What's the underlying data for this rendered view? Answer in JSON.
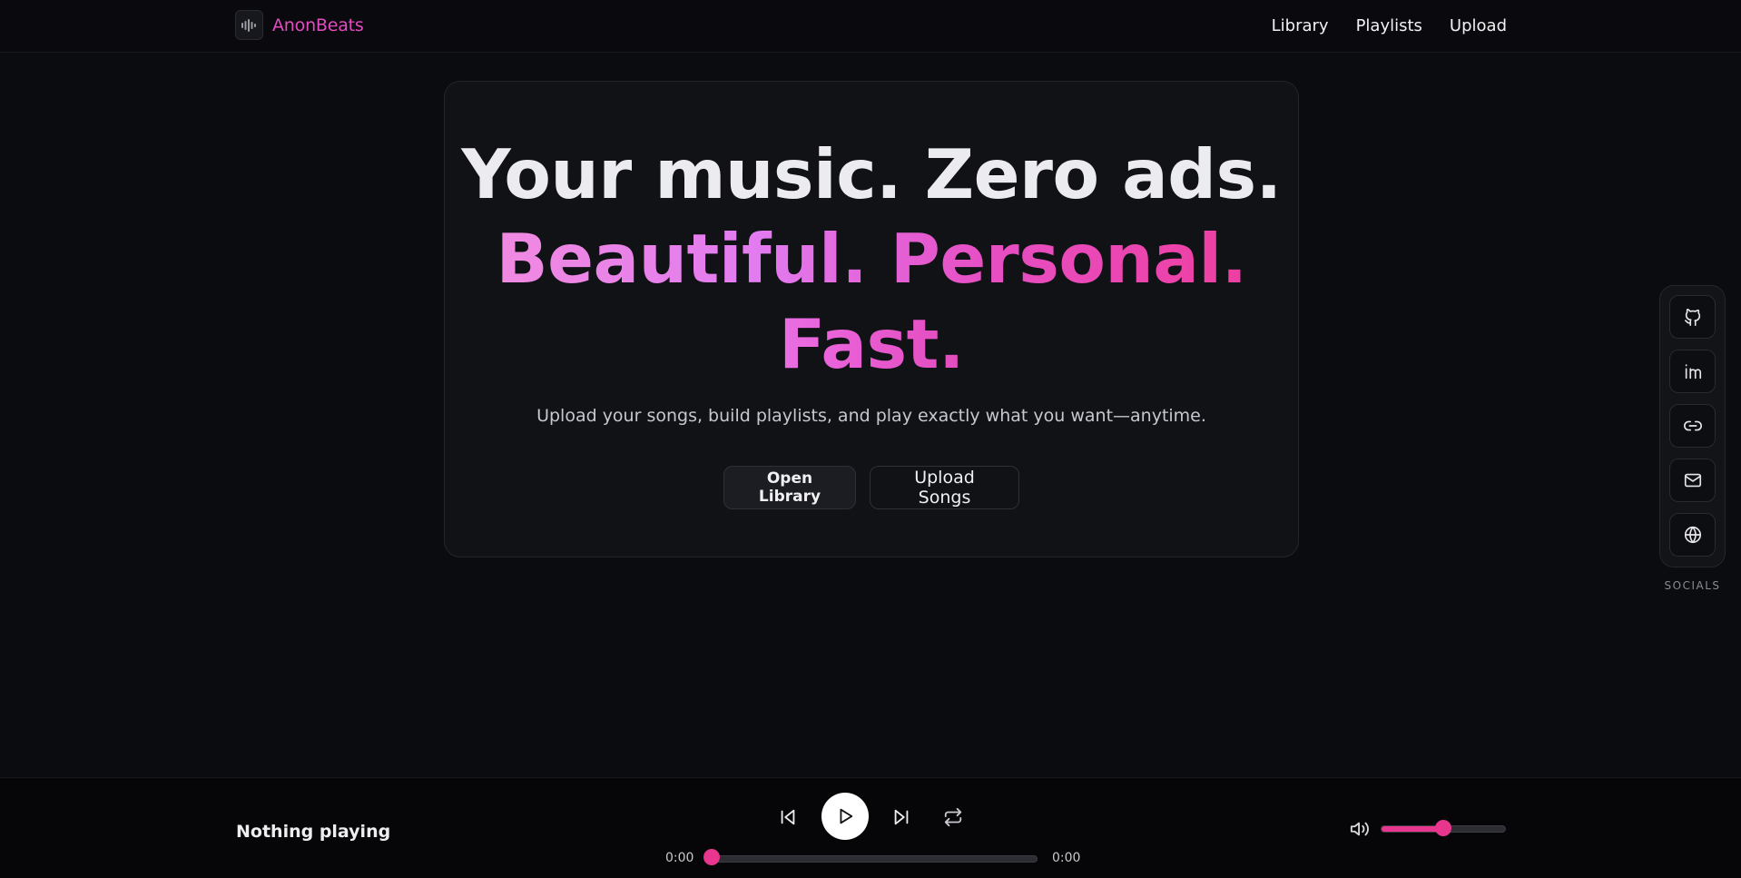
{
  "header": {
    "brand": "AnonBeats",
    "nav": [
      "Library",
      "Playlists",
      "Upload"
    ]
  },
  "hero": {
    "line1": "Your music. Zero ads.",
    "line2": "Beautiful. Personal.",
    "line3": "Fast.",
    "subtitle": "Upload your songs, build playlists, and play exactly what you want—anytime.",
    "primary_button": "Open Library",
    "secondary_button": "Upload Songs"
  },
  "socials": {
    "label": "SOCIALS",
    "items": [
      "github-icon",
      "linkedin-icon",
      "link-icon",
      "mail-icon",
      "globe-icon"
    ]
  },
  "player": {
    "now_playing": "Nothing playing",
    "current_time": "0:00",
    "duration": "0:00",
    "progress": 0,
    "volume": 0.5
  },
  "colors": {
    "accent": "#e8368f",
    "brand": "#e24cc0",
    "background": "#0b0c10"
  }
}
